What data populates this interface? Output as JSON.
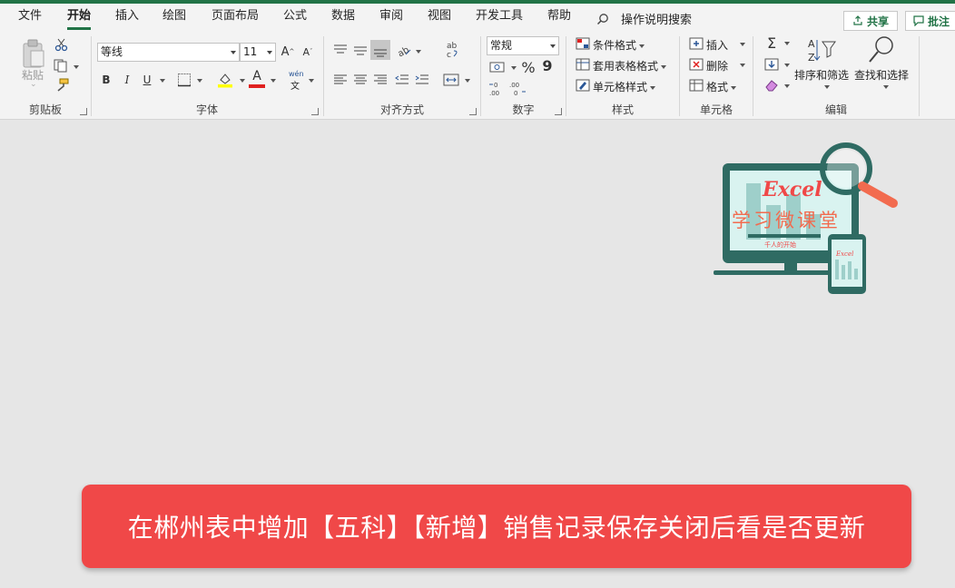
{
  "tabs": [
    {
      "label": "文件",
      "active": false
    },
    {
      "label": "开始",
      "active": true
    },
    {
      "label": "插入",
      "active": false
    },
    {
      "label": "绘图",
      "active": false
    },
    {
      "label": "页面布局",
      "active": false
    },
    {
      "label": "公式",
      "active": false
    },
    {
      "label": "数据",
      "active": false
    },
    {
      "label": "审阅",
      "active": false
    },
    {
      "label": "视图",
      "active": false
    },
    {
      "label": "开发工具",
      "active": false
    },
    {
      "label": "帮助",
      "active": false
    }
  ],
  "search": {
    "label": "操作说明搜索"
  },
  "share": {
    "label": "共享"
  },
  "comments": {
    "label": "批注"
  },
  "ribbon": {
    "clipboard": {
      "paste": "粘贴",
      "group": "剪贴板"
    },
    "font": {
      "name": "等线",
      "size": "11",
      "phonetic": "wén",
      "phonetic_char": "文",
      "group": "字体",
      "bold": "B",
      "italic": "I",
      "underline": "U"
    },
    "alignment": {
      "group": "对齐方式"
    },
    "number": {
      "format": "常规",
      "percent": "%",
      "comma": "9",
      "group": "数字"
    },
    "styles": {
      "conditional": "条件格式",
      "table": "套用表格格式",
      "cell": "单元格样式",
      "group": "样式"
    },
    "cells": {
      "insert": "插入",
      "delete": "删除",
      "format": "格式",
      "group": "单元格"
    },
    "editing": {
      "sort": "排序和筛选",
      "find": "查找和选择",
      "group": "编辑",
      "sum": "Σ"
    }
  },
  "logo": {
    "title": "Excel",
    "subtitle": "学习微课堂",
    "small_text": "千人的开始",
    "phone_text": "Excel"
  },
  "banner": {
    "text": "在郴州表中增加【五科】【新增】销售记录保存关闭后看是否更新"
  },
  "colors": {
    "accent": "#217346",
    "banner": "#f04848",
    "logo_teal": "#2f6b63",
    "logo_orange": "#f26b4f"
  }
}
